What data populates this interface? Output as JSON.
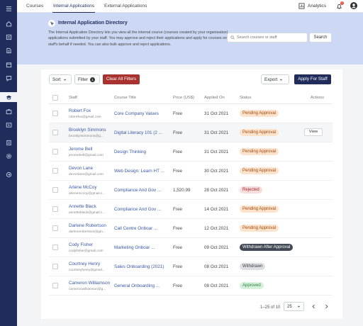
{
  "nav": {
    "tabs": [
      {
        "label": "Courses"
      },
      {
        "label": "Internal Applications"
      },
      {
        "label": "External Applications"
      }
    ],
    "analytics_label": "Analytics",
    "notification_count": "1"
  },
  "hero": {
    "title": "Internal Application Directory",
    "description": "The Internal Application Directory lets you view all the internal course (courses created by your organisation) applications submitted by your staff. You may approve and reject their applications and apply for courses on a staff's behalf if needed. You can also bulk approve and reject applications.",
    "search_placeholder": "Search courses or staff",
    "search_button": "Search"
  },
  "toolbar": {
    "sort_label": "Sort",
    "filter_label": "Filter",
    "filter_count": "1",
    "clear_label": "Clear All Filters",
    "export_label": "Export",
    "apply_label": "Apply For Staff"
  },
  "table": {
    "headers": [
      "Staff",
      "Course Title",
      "Price (US$)",
      "Applied On",
      "Status",
      "Actions"
    ],
    "view_label": "View",
    "rows": [
      {
        "name": "Robert Fox",
        "email": "robertfox@gmail.com",
        "course": "Core Company Values",
        "price": "Free",
        "date": "31 Oct 2021",
        "status": "Pending Approval"
      },
      {
        "name": "Brooklyn Simmons",
        "email": "brooklynsimmons@g...",
        "course": "Digital Literacy 101 (2 ...",
        "price": "Free",
        "date": "31 Oct 2021",
        "status": "Pending Approval"
      },
      {
        "name": "Jerome Bell",
        "email": "jeromebell@gmail.com",
        "course": "Design Thinking",
        "price": "Free",
        "date": "31 Oct 2021",
        "status": "Pending Approval"
      },
      {
        "name": "Devon Lane",
        "email": "devonlane@gmail.com",
        "course": "Web Design: Learn HT ...",
        "price": "Free",
        "date": "30 Oct 2021",
        "status": "Pending Approval"
      },
      {
        "name": "Arlene McCoy",
        "email": "arlenemccoy@gmail.c...",
        "course": "Compliance And Gov ...",
        "price": "1,520.99",
        "date": "28 Oct 2021",
        "status": "Rejected"
      },
      {
        "name": "Annette Black",
        "email": "annetteblack@gmail.c...",
        "course": "Compliance And Gov ...",
        "price": "Free",
        "date": "14 Oct 2021",
        "status": "Pending Approval"
      },
      {
        "name": "Darlene Robertson",
        "email": "darlenerobertson@gm...",
        "course": "Call Centre Onboar ...",
        "price": "Free",
        "date": "12 Oct 2021",
        "status": "Pending Approval"
      },
      {
        "name": "Cody Fisher",
        "email": "codyfisher@gmail.com",
        "course": "Marketing Onboar ...",
        "price": "Free",
        "date": "09 Oct 2021",
        "status": "Withdrawn After Approval"
      },
      {
        "name": "Courtney Henry",
        "email": "courtneyhenry@gmail...",
        "course": "Sales Onboarding (2021)",
        "price": "Free",
        "date": "08 Oct 2021",
        "status": "Withdrawn"
      },
      {
        "name": "Cameron Williamson",
        "email": "cameronwilliamson@g...",
        "course": "General Onboarding ...",
        "price": "Free",
        "date": "08 Oct 2021",
        "status": "Approved"
      }
    ]
  },
  "pagination": {
    "range": "1–25 of 10",
    "per_page": "25"
  },
  "colors": {
    "sidebar": "#1f2c5c",
    "hero": "#cdd9f4",
    "primary": "#1f2c5c",
    "danger": "#a8322d"
  }
}
